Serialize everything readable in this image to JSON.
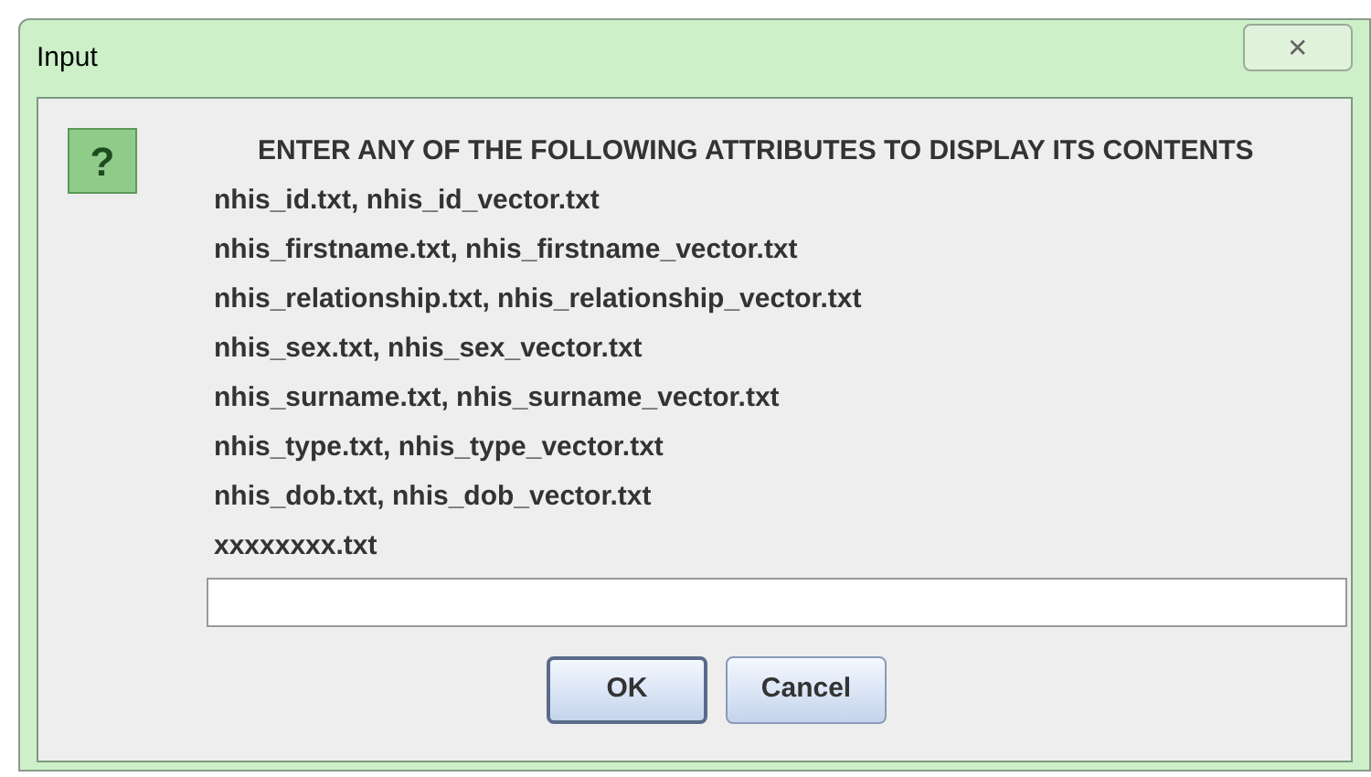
{
  "window": {
    "title": "Input",
    "close": "✕"
  },
  "icon": "?",
  "heading": "ENTER ANY OF THE FOLLOWING ATTRIBUTES TO DISPLAY ITS CONTENTS",
  "lines": [
    "nhis_id.txt, nhis_id_vector.txt",
    "nhis_firstname.txt, nhis_firstname_vector.txt",
    "nhis_relationship.txt, nhis_relationship_vector.txt",
    "nhis_sex.txt, nhis_sex_vector.txt",
    "nhis_surname.txt, nhis_surname_vector.txt",
    "nhis_type.txt, nhis_type_vector.txt",
    "nhis_dob.txt, nhis_dob_vector.txt",
    "xxxxxxxx.txt"
  ],
  "buttons": [
    {
      "label": "OK",
      "selected": true
    },
    {
      "label": "Cancel",
      "selected": false
    }
  ]
}
